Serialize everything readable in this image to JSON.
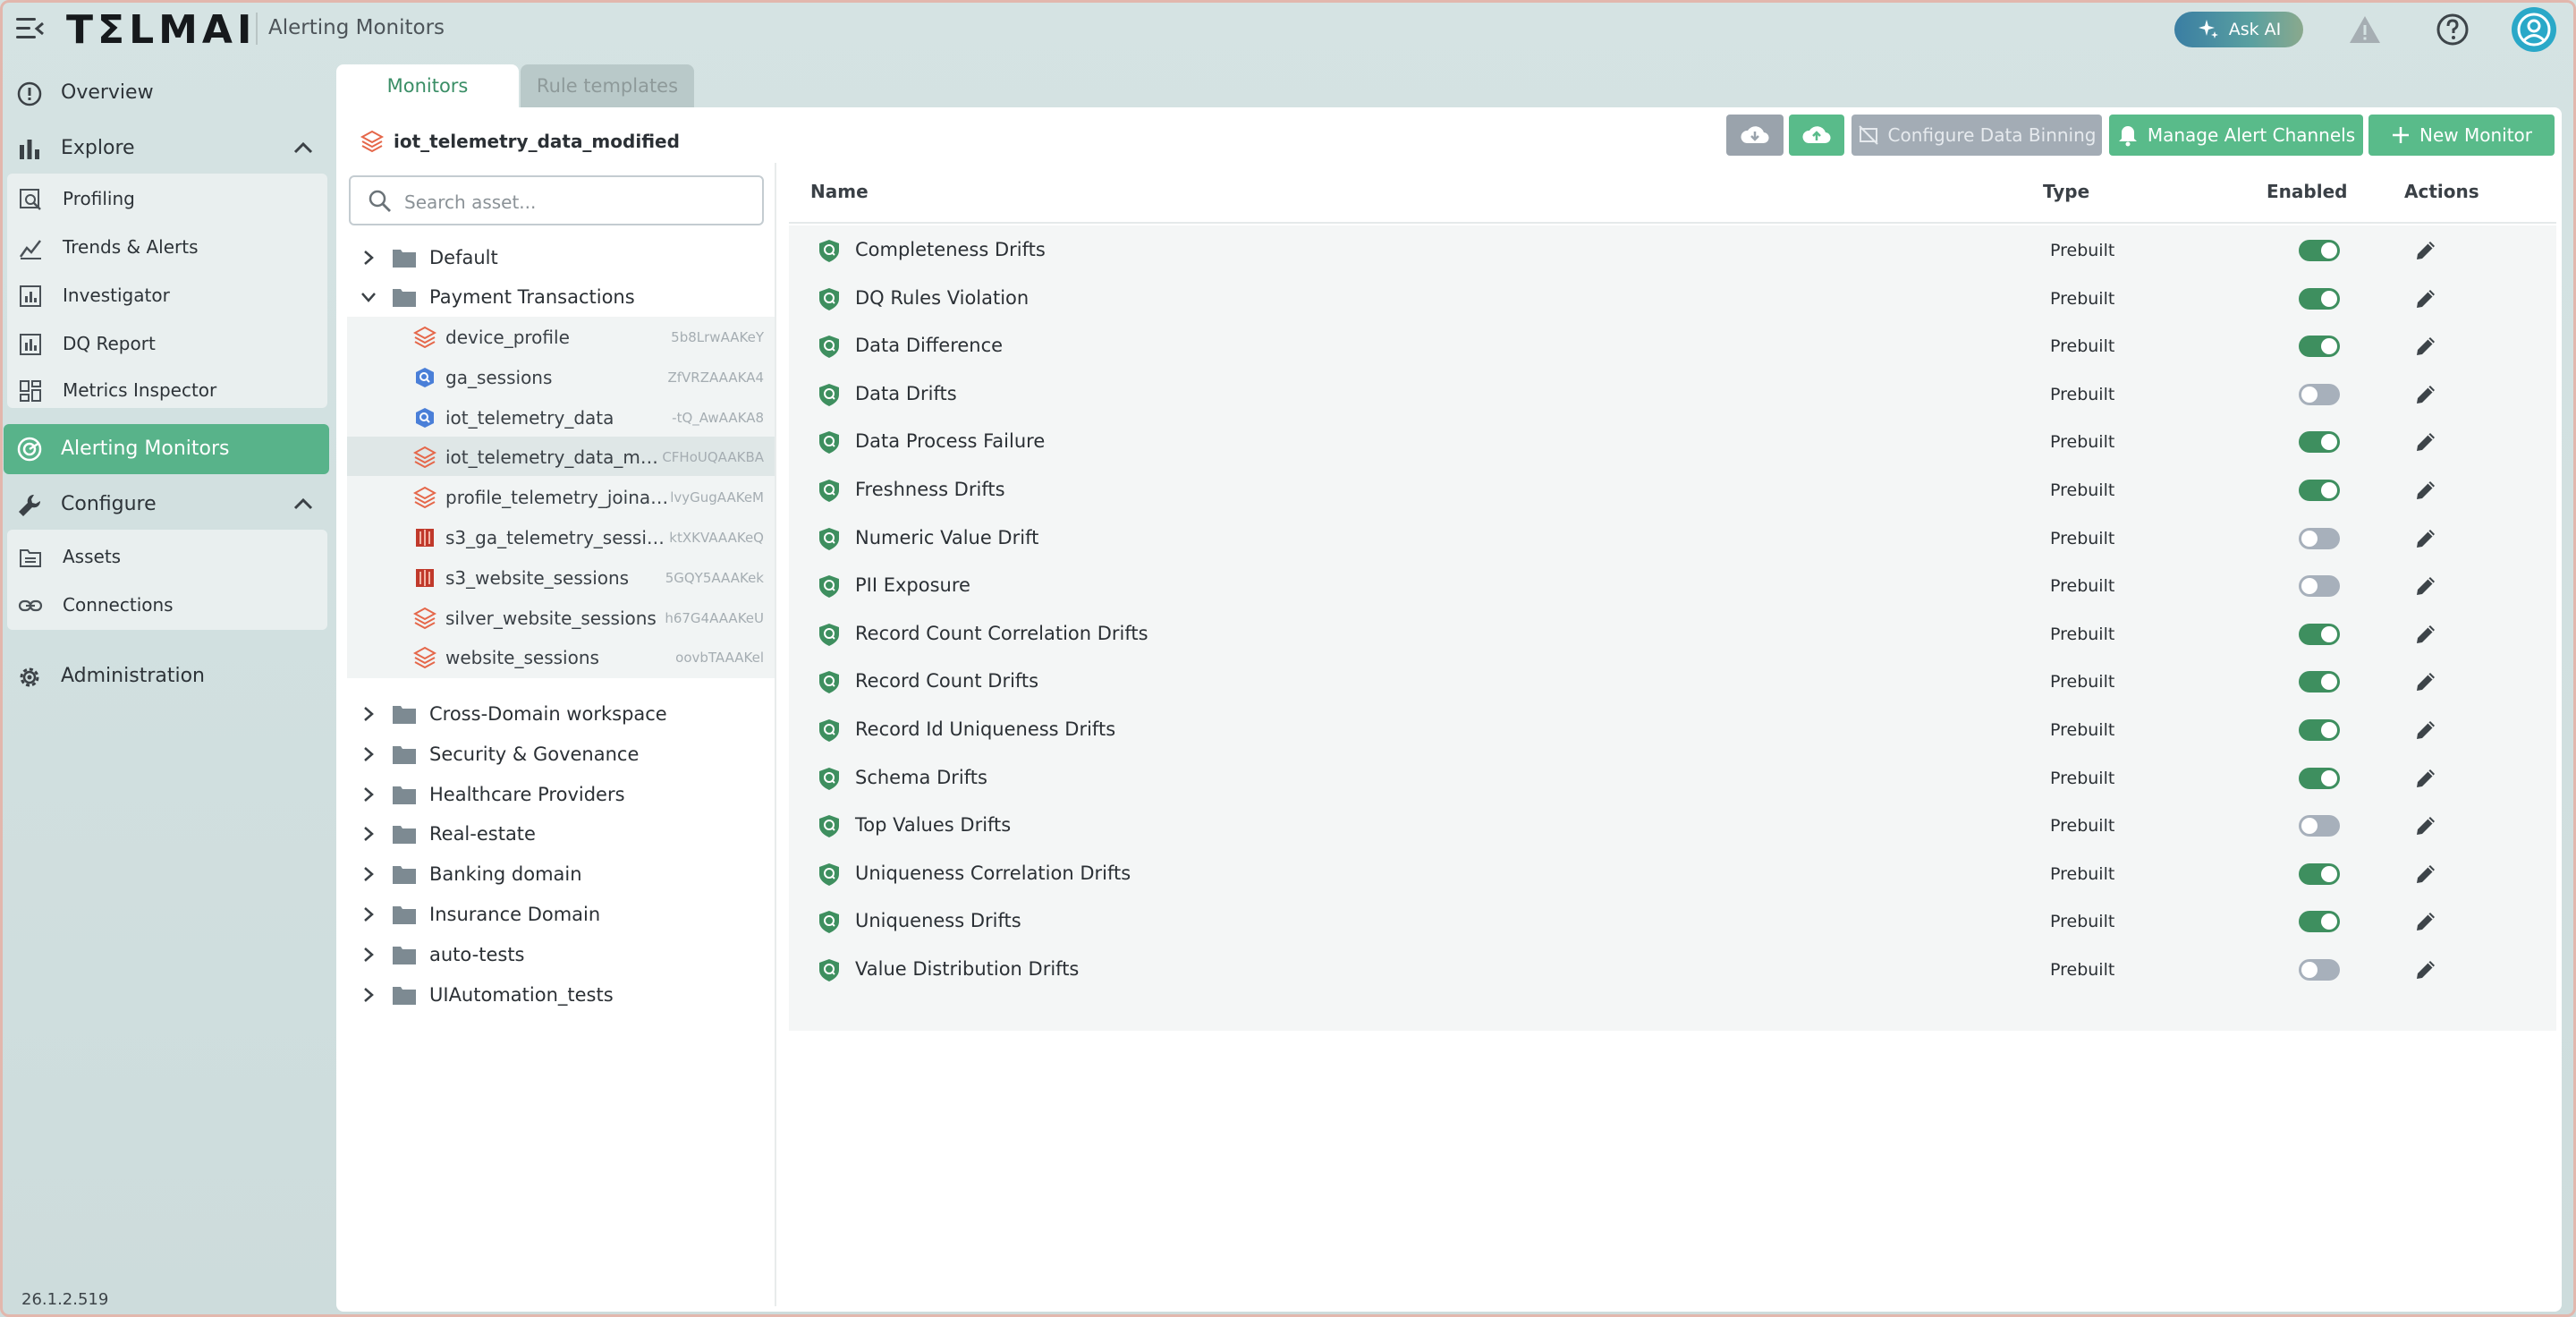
{
  "header": {
    "logo": "TΣLMAI",
    "app_title": "Alerting Monitors",
    "ask_ai_label": "Ask AI",
    "icons": [
      "menu-icon",
      "sparkle-icon",
      "warning-icon",
      "help-icon",
      "user-avatar-icon"
    ]
  },
  "sidebar": {
    "overview": "Overview",
    "explore": "Explore",
    "explore_items": [
      "Profiling",
      "Trends & Alerts",
      "Investigator",
      "DQ Report",
      "Metrics Inspector"
    ],
    "alerting_monitors": "Alerting Monitors",
    "configure": "Configure",
    "configure_items": [
      "Assets",
      "Connections"
    ],
    "administration": "Administration",
    "version": "26.1.2.519"
  },
  "tabs": [
    "Monitors",
    "Rule templates"
  ],
  "asset_header": {
    "selected_asset": "iot_telemetry_data_modified"
  },
  "toolbar": {
    "configure_binning": "Configure Data Binning",
    "manage_alerts": "Manage Alert Channels",
    "new_monitor": "New Monitor"
  },
  "tree": {
    "search_placeholder": "Search asset...",
    "folders_top": [
      "Default",
      "Payment Transactions"
    ],
    "assets": [
      {
        "name": "device_profile",
        "id": "5b8LrwAAKeY",
        "kind": "delta"
      },
      {
        "name": "ga_sessions",
        "id": "ZfVRZAAAKA4",
        "kind": "bigquery"
      },
      {
        "name": "iot_telemetry_data",
        "id": "-tQ_AwAAKA8",
        "kind": "bigquery"
      },
      {
        "name": "iot_telemetry_data_mod...",
        "id": "CFHoUQAAKBA",
        "kind": "delta",
        "selected": true
      },
      {
        "name": "profile_telemetry_joinabil...",
        "id": "lvyGugAAKeM",
        "kind": "delta"
      },
      {
        "name": "s3_ga_telemetry_sessions",
        "id": "ktXKVAAAKeQ",
        "kind": "s3"
      },
      {
        "name": "s3_website_sessions",
        "id": "5GQY5AAAKek",
        "kind": "s3"
      },
      {
        "name": "silver_website_sessions",
        "id": "h67G4AAAKeU",
        "kind": "delta"
      },
      {
        "name": "website_sessions",
        "id": "oovbTAAAKel",
        "kind": "delta"
      }
    ],
    "folders_bottom": [
      "Cross-Domain workspace",
      "Security & Govenance",
      "Healthcare Providers",
      "Real-estate",
      "Banking domain",
      "Insurance Domain",
      "auto-tests",
      "UIAutomation_tests"
    ]
  },
  "table": {
    "columns": [
      "Name",
      "Type",
      "Enabled",
      "Actions"
    ],
    "rows": [
      {
        "name": "Completeness Drifts",
        "type": "Prebuilt",
        "enabled": true
      },
      {
        "name": "DQ Rules Violation",
        "type": "Prebuilt",
        "enabled": true
      },
      {
        "name": "Data Difference",
        "type": "Prebuilt",
        "enabled": true
      },
      {
        "name": "Data Drifts",
        "type": "Prebuilt",
        "enabled": false
      },
      {
        "name": "Data Process Failure",
        "type": "Prebuilt",
        "enabled": true
      },
      {
        "name": "Freshness Drifts",
        "type": "Prebuilt",
        "enabled": true
      },
      {
        "name": "Numeric Value Drift",
        "type": "Prebuilt",
        "enabled": false
      },
      {
        "name": "PII Exposure",
        "type": "Prebuilt",
        "enabled": false
      },
      {
        "name": "Record Count Correlation Drifts",
        "type": "Prebuilt",
        "enabled": true
      },
      {
        "name": "Record Count Drifts",
        "type": "Prebuilt",
        "enabled": true
      },
      {
        "name": "Record Id Uniqueness Drifts",
        "type": "Prebuilt",
        "enabled": true
      },
      {
        "name": "Schema Drifts",
        "type": "Prebuilt",
        "enabled": true
      },
      {
        "name": "Top Values Drifts",
        "type": "Prebuilt",
        "enabled": false
      },
      {
        "name": "Uniqueness Correlation Drifts",
        "type": "Prebuilt",
        "enabled": true
      },
      {
        "name": "Uniqueness Drifts",
        "type": "Prebuilt",
        "enabled": true
      },
      {
        "name": "Value Distribution Drifts",
        "type": "Prebuilt",
        "enabled": false
      }
    ]
  },
  "colors": {
    "accent_green": "#59bb8a",
    "active_nav": "#58b38a",
    "toggle_on": "#3e8f5f",
    "toggle_off": "#a7b0bb",
    "delta_icon": "#e5674a",
    "bigquery_icon": "#4a7fd8",
    "s3_icon": "#c0392b"
  }
}
